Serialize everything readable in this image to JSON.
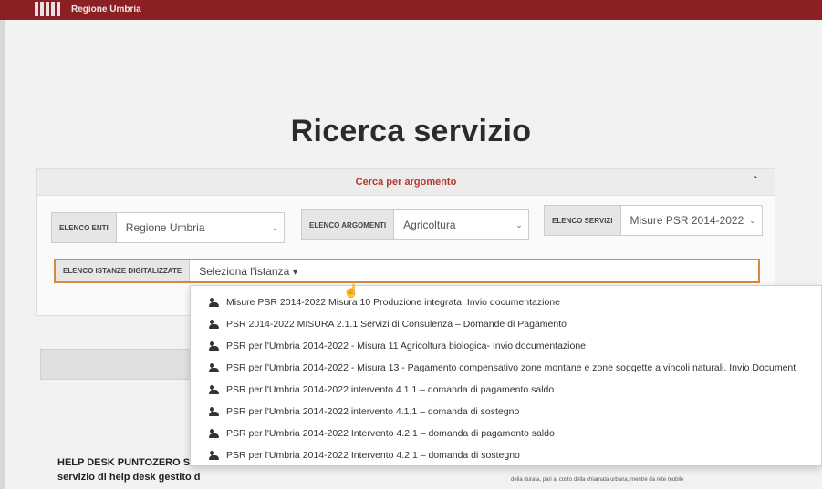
{
  "header": {
    "brand": "Regione Umbria"
  },
  "page": {
    "title": "Ricerca servizio"
  },
  "panel": {
    "title": "Cerca per argomento"
  },
  "filters": {
    "enti": {
      "label": "ELENCO ENTI",
      "value": "Regione Umbria"
    },
    "argomenti": {
      "label": "ELENCO ARGOMENTI",
      "value": "Agricoltura"
    },
    "servizi": {
      "label": "ELENCO SERVIZI",
      "value": "Misure PSR 2014-2022"
    },
    "istanze": {
      "label": "ELENCO ISTANZE DIGITALIZZATE",
      "value": "Seleziona l'istanza"
    }
  },
  "dropdown": {
    "options": [
      "Misure PSR 2014-2022 Misura 10 Produzione integrata. Invio documentazione",
      "PSR 2014-2022 MISURA 2.1.1 Servizi di Consulenza – Domande di Pagamento",
      "PSR per l'Umbria 2014-2022 - Misura 11 Agricoltura biologica- Invio documentazione",
      "PSR per l'Umbria 2014-2022 - Misura 13 - Pagamento compensativo zone montane e zone soggette a vincoli naturali. Invio Document",
      "PSR per l'Umbria 2014-2022 intervento 4.1.1 – domanda di pagamento saldo",
      "PSR per l'Umbria 2014-2022 intervento 4.1.1 – domanda di sostegno",
      "PSR per l'Umbria 2014-2022 Intervento 4.2.1 – domanda di pagamento saldo",
      "PSR per l'Umbria 2014-2022 Intervento 4.2.1 – domanda di sostegno"
    ]
  },
  "helpdesk": {
    "title": "HELP DESK PUNTOZERO SCAI",
    "text": "servizio di help desk gestito d",
    "small": "della durata, pari al costo della chiamata urbana, mentre da rete mobile"
  }
}
